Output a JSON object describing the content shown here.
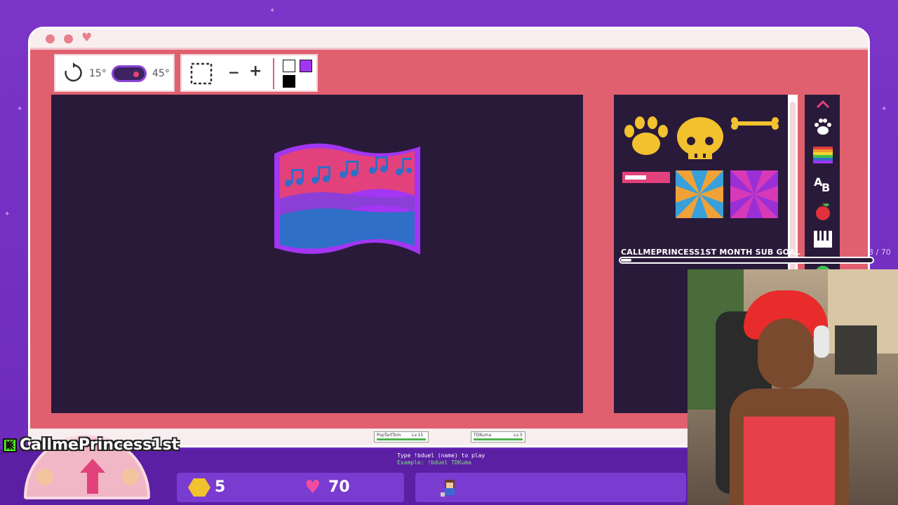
{
  "toolbar": {
    "rotate_min": "15°",
    "rotate_max": "45°",
    "zoom_out": "−",
    "zoom_in": "+",
    "colors": {
      "secondary": "#ffffff",
      "primary": "#a236f2",
      "tertiary": "#000000"
    }
  },
  "palette": {
    "items": [
      "paw-stamp",
      "skull-stamp",
      "bone-stamp",
      "pink-bar-stamp",
      "sunburst-orange-blue",
      "sunburst-purple-magenta"
    ],
    "categories": [
      "paw-icon",
      "rainbow-icon",
      "letters-icon",
      "apple-icon",
      "piano-icon",
      "leaf-icon"
    ]
  },
  "sub_goal": {
    "label": "CALLMEPRINCESS1ST MONTH SUB GOAL",
    "count": "3 / 70",
    "progress": 0.043
  },
  "duel": {
    "player1": "PopTartTom",
    "player1_level": "Lv.15",
    "player2": "TDKuma",
    "player2_level": "Lv.3",
    "instruction": "Type !bduel (name) to play",
    "example": "Example: !bduel TDKuma"
  },
  "streamer": {
    "name": "CallmePrincess1st",
    "platform_icon": "K"
  },
  "hud": {
    "coins": "5",
    "hearts": "70"
  },
  "colors": {
    "window_body": "#e06070",
    "canvas_bg": "#291a3a",
    "accent_purple": "#a236f2",
    "flag_pink": "#e2417c",
    "flag_purple": "#8a3fd6",
    "flag_blue": "#2f6fc7"
  }
}
